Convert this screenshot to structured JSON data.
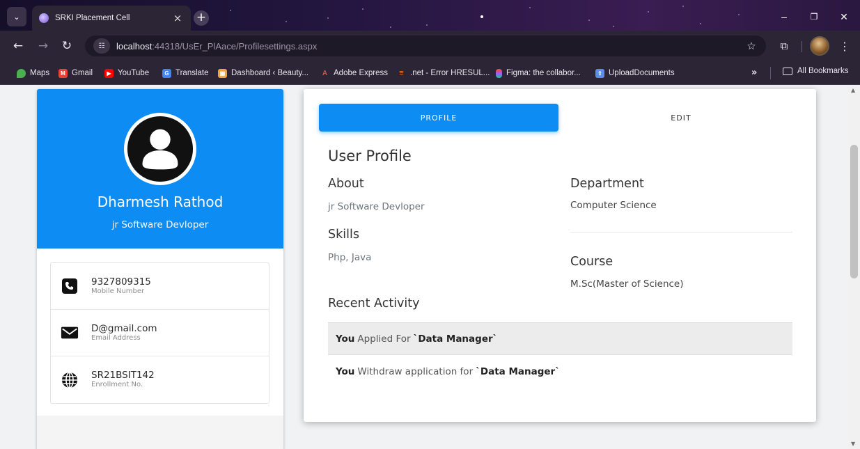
{
  "browser": {
    "tab": {
      "title": "SRKI Placement Cell",
      "close_glyph": "×"
    },
    "new_tab_glyph": "+",
    "window_controls": {
      "minimize": "–",
      "restore": "❐",
      "close": "✕"
    },
    "url": {
      "host": "localhost",
      "rest": ":44318/UsEr_PlAace/Profilesettings.aspx"
    },
    "bookmarks": [
      {
        "label": "Maps",
        "icon": "maps-icon",
        "color": "#4caf50"
      },
      {
        "label": "Gmail",
        "icon": "gmail-icon",
        "color": "#ea4335"
      },
      {
        "label": "YouTube",
        "icon": "youtube-icon",
        "color": "#ff0000"
      },
      {
        "label": "Translate",
        "icon": "translate-icon",
        "color": "#4285f4"
      },
      {
        "label": "Dashboard ‹ Beauty...",
        "icon": "dashboard-icon",
        "color": "#f2a33a"
      },
      {
        "label": "Adobe Express",
        "icon": "adobe-icon",
        "color": "#e34850"
      },
      {
        "label": ".net - Error HRESUL...",
        "icon": "stackoverflow-icon",
        "color": "#f48024"
      },
      {
        "label": "Figma: the collabor...",
        "icon": "figma-icon",
        "color": "#a259ff"
      },
      {
        "label": "UploadDocuments",
        "icon": "upload-documents-icon",
        "color": "#5b8def"
      }
    ],
    "more_bookmarks": "»",
    "all_bookmarks": "All Bookmarks"
  },
  "profile_card": {
    "name": "Dharmesh Rathod",
    "role": "jr Software Devloper",
    "contacts": [
      {
        "value": "9327809315",
        "label": "Mobile Number",
        "icon": "phone-icon"
      },
      {
        "value": "D@gmail.com",
        "label": "Email Address",
        "icon": "envelope-icon"
      },
      {
        "value": "SR21BSIT142",
        "label": "Enrollment No.",
        "icon": "globe-icon"
      }
    ]
  },
  "details": {
    "tabs": {
      "profile": "PROFILE",
      "edit": "EDIT"
    },
    "title": "User Profile",
    "about": {
      "heading": "About",
      "value": "jr Software Devloper"
    },
    "skills": {
      "heading": "Skills",
      "value": "Php, Java"
    },
    "department": {
      "heading": "Department",
      "value": "Computer Science"
    },
    "course": {
      "heading": "Course",
      "value": "M.Sc(Master of Science)"
    },
    "recent_activity": {
      "heading": "Recent Activity",
      "items": [
        {
          "actor": "You",
          "text": "Applied For",
          "job": "`Data Manager`"
        },
        {
          "actor": "You",
          "text": "Withdraw application for",
          "job": "`Data Manager`"
        }
      ]
    }
  },
  "colors": {
    "primary": "#0d8cf4",
    "chrome": "#2c2535"
  }
}
